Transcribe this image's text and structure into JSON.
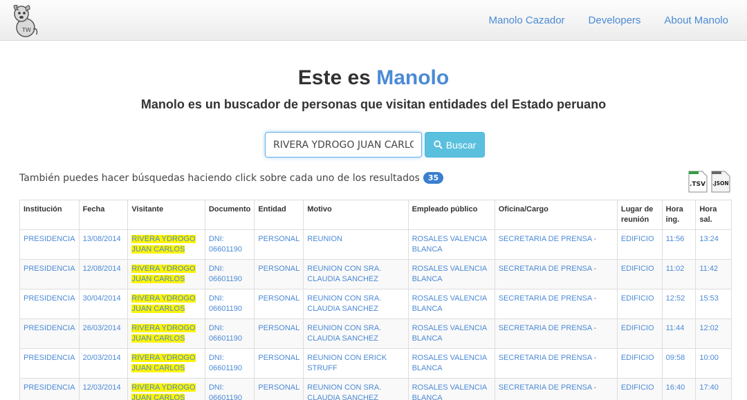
{
  "nav": {
    "links": [
      "Manolo Cazador",
      "Developers",
      "About Manolo"
    ]
  },
  "hero": {
    "title_prefix": "Este es",
    "title_accent": "Manolo",
    "subtitle": "Manolo es un buscador de personas que visitan entidades del Estado peruano"
  },
  "search": {
    "value": "RIVERA YDROGO JUAN CARLOS",
    "button_label": "Buscar"
  },
  "results": {
    "hint": "También puedes hacer búsquedas haciendo click sobre cada uno de los resultados",
    "count": "35",
    "export_tsv_label": ".TSV",
    "export_json_label": ".JSON"
  },
  "table": {
    "headers": [
      "Institución",
      "Fecha",
      "Visitante",
      "Documento",
      "Entidad",
      "Motivo",
      "Empleado público",
      "Oficina/Cargo",
      "Lugar de reunión",
      "Hora ing.",
      "Hora sal."
    ],
    "rows": [
      [
        "PRESIDENCIA",
        "13/08/2014",
        "RIVERA YDROGO JUAN CARLOS",
        "DNI: 06601190",
        "PERSONAL",
        "REUNION",
        "ROSALES VALENCIA BLANCA",
        "SECRETARIA DE PRENSA -",
        "EDIFICIO",
        "11:56",
        "13:24"
      ],
      [
        "PRESIDENCIA",
        "12/08/2014",
        "RIVERA YDROGO JUAN CARLOS",
        "DNI: 06601190",
        "PERSONAL",
        "REUNION CON SRA. CLAUDIA SANCHEZ",
        "ROSALES VALENCIA BLANCA",
        "SECRETARIA DE PRENSA -",
        "EDIFICIO",
        "11:02",
        "11:42"
      ],
      [
        "PRESIDENCIA",
        "30/04/2014",
        "RIVERA YDROGO JUAN CARLOS",
        "DNI: 06601190",
        "PERSONAL",
        "REUNION CON SRA. CLAUDIA SANCHEZ",
        "ROSALES VALENCIA BLANCA",
        "SECRETARIA DE PRENSA -",
        "EDIFICIO",
        "12:52",
        "15:53"
      ],
      [
        "PRESIDENCIA",
        "26/03/2014",
        "RIVERA YDROGO JUAN CARLOS",
        "DNI: 06601190",
        "PERSONAL",
        "REUNION CON SRA. CLAUDIA SANCHEZ",
        "ROSALES VALENCIA BLANCA",
        "SECRETARIA DE PRENSA -",
        "EDIFICIO",
        "11:44",
        "12:02"
      ],
      [
        "PRESIDENCIA",
        "20/03/2014",
        "RIVERA YDROGO JUAN CARLOS",
        "DNI: 06601190",
        "PERSONAL",
        "REUNION CON ERICK STRUFF",
        "ROSALES VALENCIA BLANCA",
        "SECRETARIA DE PRENSA -",
        "EDIFICIO",
        "09:58",
        "10:00"
      ],
      [
        "PRESIDENCIA",
        "12/03/2014",
        "RIVERA YDROGO JUAN CARLOS",
        "DNI: 06601190",
        "PERSONAL",
        "REUNION CON SRA. CLAUDIA SANCHEZ",
        "ROSALES VALENCIA BLANCA",
        "SECRETARIA DE PRENSA -",
        "EDIFICIO",
        "16:40",
        "17:40"
      ]
    ]
  },
  "colors": {
    "accent": "#4b8ad6",
    "button": "#5bc0de",
    "highlight": "#fcf300",
    "badge": "#3a7fd0"
  },
  "icons": {
    "logo": "manolo-dog-logo",
    "search": "search-icon",
    "tsv": "tsv-file-icon",
    "json": "json-file-icon"
  }
}
